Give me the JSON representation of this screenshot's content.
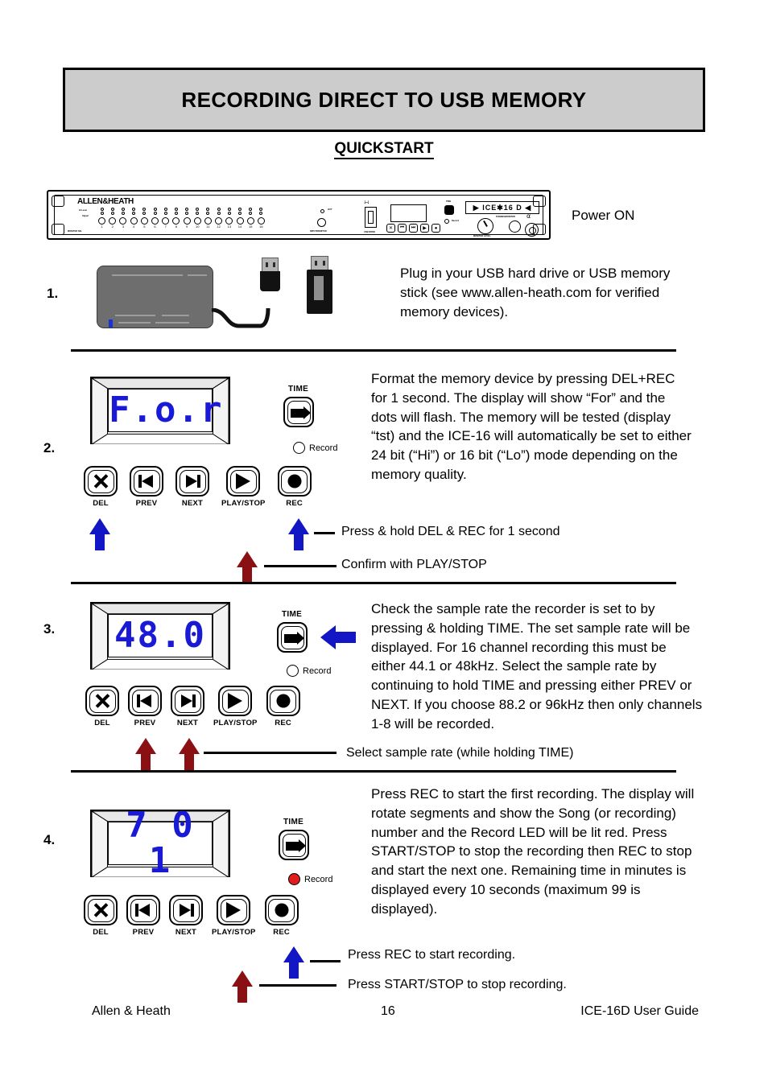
{
  "banner": {
    "title": "RECORDING DIRECT TO USB MEMORY"
  },
  "quickstart": {
    "label": "QUICKSTART"
  },
  "device": {
    "brand": "ALLEN&HEATH",
    "logo": "▶ ICE✱16 D ◀",
    "label_hilevel": "Hi Level",
    "label_signal": "Signal",
    "label_monitor_sel": "MONITOR SEL",
    "label_input_monitor": "INPUT/MONITOR",
    "label_out": "OUT",
    "label_usb_drive": "USB DRIVE",
    "label_time": "TIME",
    "label_record": "Record",
    "label_monitor_level": "MONITOR LEVEL",
    "label_phones_monitor": "PHONES/MONITOR",
    "channels": [
      "1",
      "2",
      "3",
      "4",
      "5",
      "6",
      "7",
      "8",
      "9",
      "10",
      "11",
      "12",
      "13",
      "14",
      "15",
      "16"
    ],
    "transport": [
      "DEL",
      "PREV",
      "NEXT",
      "PLAY/STOP",
      "REC"
    ]
  },
  "power_on": {
    "label": "Power ON"
  },
  "steps": [
    {
      "number": "1.",
      "text": "Plug in your USB hard drive or USB memory stick (see www.allen-heath.com for verified memory devices)."
    },
    {
      "number": "2.",
      "display": "F.o.r",
      "text": "Format the memory device by pressing DEL+REC for 1 second. The display will show “For” and the dots will flash. The memory will be tested (display “tst) and the ICE-16 will automatically be set to either 24 bit (“Hi”) or 16 bit (“Lo”) mode depending on the memory quality.",
      "annotations": [
        {
          "text": "Press & hold DEL & REC for 1 second",
          "color": "#1316c4"
        },
        {
          "text": "Confirm with PLAY/STOP",
          "color": "#8b1013"
        }
      ]
    },
    {
      "number": "3.",
      "display": "48.0",
      "text": "Check the sample rate the recorder is set to by pressing & holding TIME. The set sample rate will be displayed. For 16 channel recording this must be either 44.1 or 48kHz. Select the sample rate by continuing to hold TIME and pressing either PREV or NEXT. If you choose 88.2 or 96kHz then only channels 1-8 will be recorded.",
      "annotations": [
        {
          "text": "Select sample rate (while holding TIME)",
          "color": "#8b1013"
        }
      ]
    },
    {
      "number": "4.",
      "display": "7 0 1",
      "text": "Press REC to start the first recording. The display will rotate segments and show the Song (or recording) number and the Record LED will be lit red. Press START/STOP to stop the recording then REC to stop and start the next one. Remaining time in minutes is displayed every 10 seconds (maximum 99 is displayed).",
      "annotations": [
        {
          "text": "Press REC to start recording.",
          "color": "#1316c4"
        },
        {
          "text": "Press START/STOP to stop recording.",
          "color": "#8b1013"
        }
      ]
    }
  ],
  "footer": {
    "left": "Allen & Heath",
    "center": "16",
    "right": "ICE-16D  User Guide"
  },
  "colors": {
    "banner_bg": "#cccccc",
    "segment_blue": "#1a1ad6",
    "arrow_blue": "#1316c4",
    "arrow_red": "#8b1013",
    "rec_led_red": "#e01c1c"
  }
}
